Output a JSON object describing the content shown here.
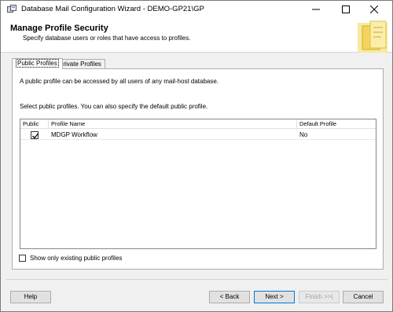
{
  "window": {
    "title": "Database Mail Configuration Wizard - DEMO-GP21\\GP"
  },
  "header": {
    "title": "Manage Profile Security",
    "subtitle": "Specify database users or roles that have access to profiles."
  },
  "tabs": [
    {
      "label": "Public Profiles",
      "active": true
    },
    {
      "label": "Private Profiles",
      "active": false
    }
  ],
  "panel": {
    "description": "A public profile can be accessed by all users of any mail-host database.",
    "instruction": "Select public profiles. You can also specify the default public profile."
  },
  "grid": {
    "columns": [
      "Public",
      "Profile Name",
      "Default Profile"
    ],
    "rows": [
      {
        "public": true,
        "profile_name": "MDGP Workflow",
        "default_profile": "No"
      }
    ]
  },
  "show_existing": {
    "label": "Show only existing public profiles",
    "checked": false
  },
  "buttons": {
    "help": "Help",
    "back": "< Back",
    "next": "Next >",
    "finish": "Finish >>|",
    "cancel": "Cancel"
  },
  "colors": {
    "accent": "#0078d7"
  },
  "icons": [
    "app-icon",
    "minimize-icon",
    "maximize-icon",
    "close-icon",
    "checkmark-icon",
    "wizard-header-art"
  ]
}
